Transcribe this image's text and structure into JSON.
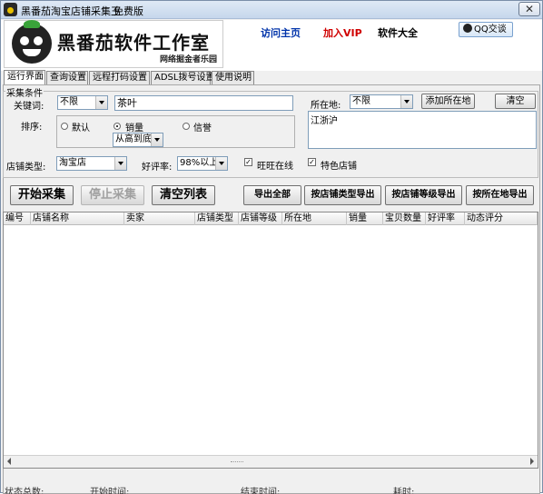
{
  "window": {
    "title": "黑番茄淘宝店铺采集王",
    "edition": "免费版"
  },
  "header": {
    "logo_main": "黑番茄软件工作室",
    "logo_sub": "网络掘金者乐园",
    "link_home": "访问主页",
    "link_vip": "加入VIP",
    "link_software": "软件大全",
    "qq_button": "QQ交谈"
  },
  "tabs": [
    {
      "label": "运行界面",
      "active": true
    },
    {
      "label": "查询设置",
      "active": false
    },
    {
      "label": "远程打码设置",
      "active": false
    },
    {
      "label": "ADSL拨号设置",
      "active": false
    },
    {
      "label": "使用说明",
      "active": false
    }
  ],
  "criteria": {
    "legend": "采集条件",
    "keyword_label": "关键词:",
    "keyword_scope": "不限",
    "keyword_value": "茶叶",
    "sort_label": "排序:",
    "sort_options": {
      "default": "默认",
      "sales": "销量",
      "credit": "信誉"
    },
    "sort_selected": "sales",
    "sort_order": "从高到底",
    "location_label": "所在地:",
    "location_scope": "不限",
    "add_location_button": "添加所在地",
    "clear_button": "清空",
    "location_list": "江浙沪",
    "shop_type_label": "店铺类型:",
    "shop_type_value": "淘宝店",
    "rating_label": "好评率:",
    "rating_value": "98%以上",
    "wangwang_online": "旺旺在线",
    "wangwang_checked": true,
    "featured_shop": "特色店铺",
    "featured_checked": true
  },
  "actions": {
    "start": "开始采集",
    "stop": "停止采集",
    "clear_list": "清空列表",
    "export_all": "导出全部",
    "export_by_type": "按店铺类型导出",
    "export_by_level": "按店铺等级导出",
    "export_by_location": "按所在地导出"
  },
  "table": {
    "columns": [
      "编号",
      "店铺名称",
      "卖家",
      "店铺类型",
      "店铺等级",
      "所在地",
      "销量",
      "宝贝数量",
      "好评率",
      "动态评分"
    ],
    "rows": []
  },
  "status": {
    "item1": "状态总数:",
    "item2": "开始时间:",
    "item3": "结束时间:",
    "item4": "耗时:"
  }
}
